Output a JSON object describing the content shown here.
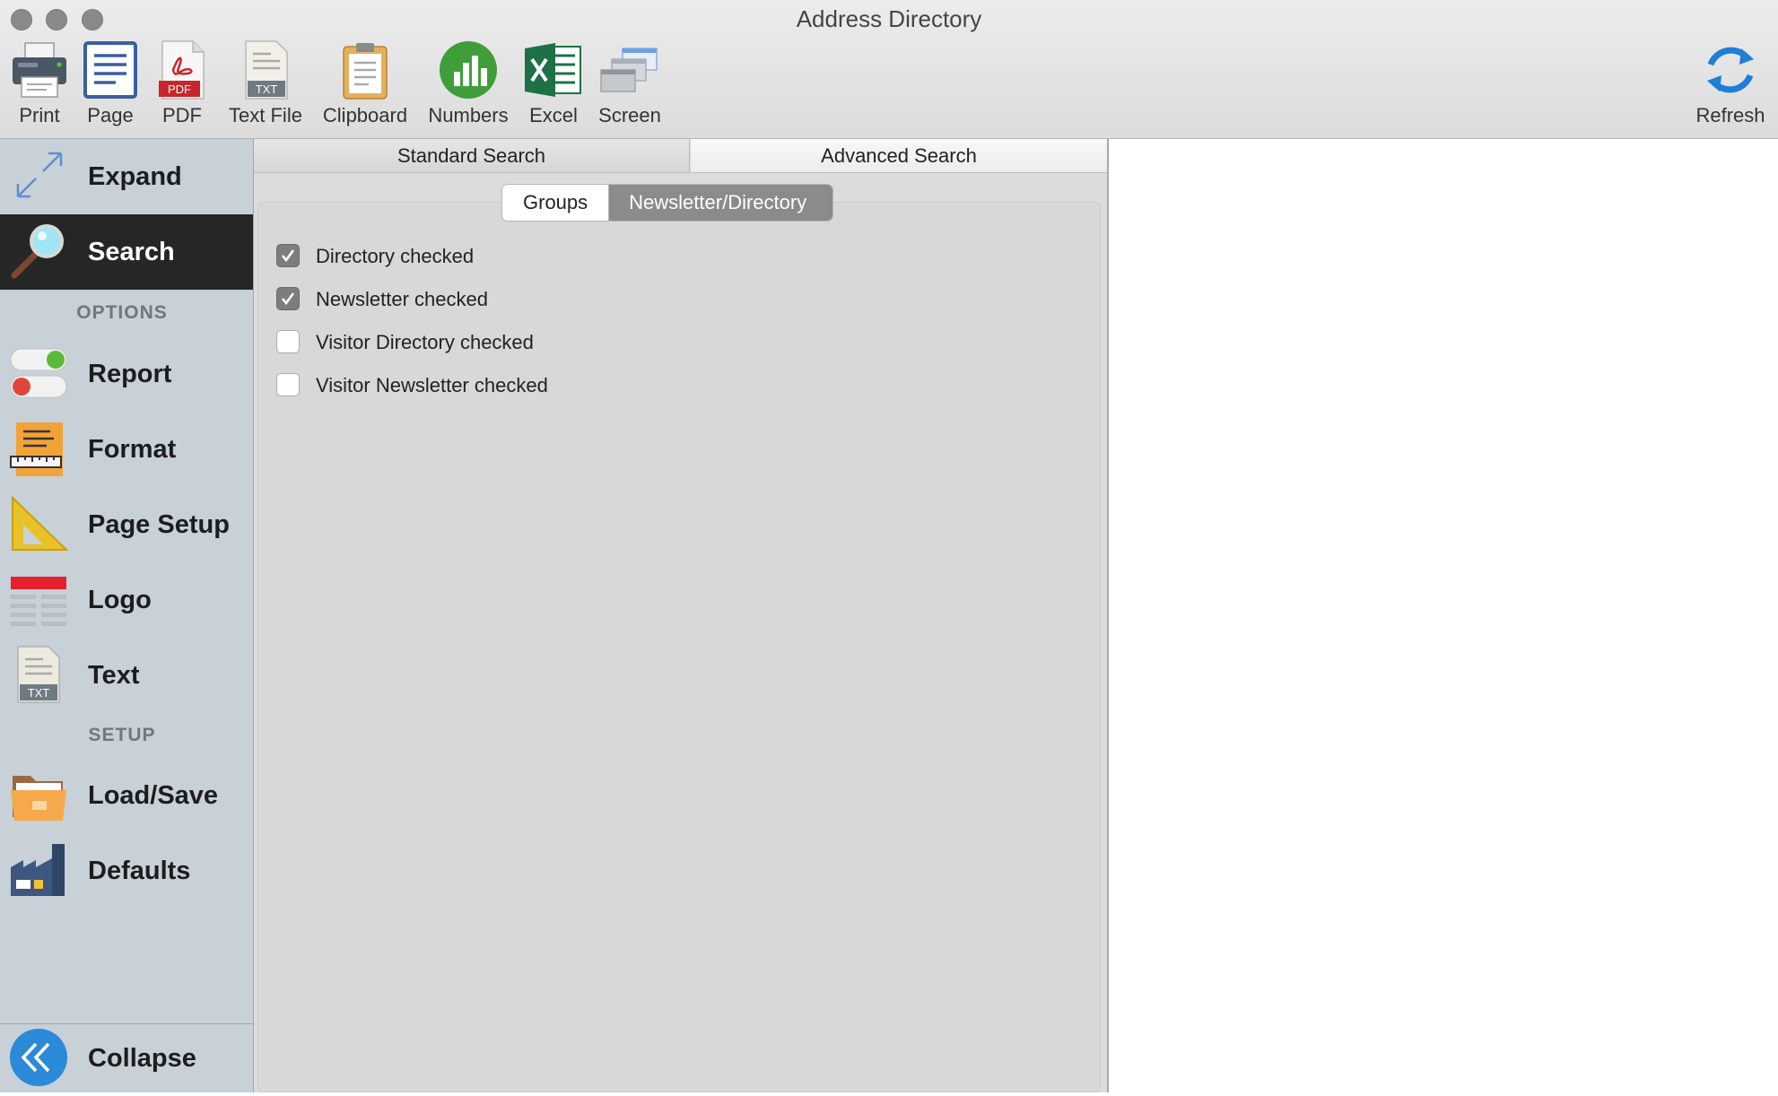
{
  "window": {
    "title": "Address Directory"
  },
  "toolbar": {
    "print": "Print",
    "page": "Page",
    "pdf": "PDF",
    "text_file": "Text File",
    "clipboard": "Clipboard",
    "numbers": "Numbers",
    "excel": "Excel",
    "screen": "Screen",
    "refresh": "Refresh",
    "pdf_badge": "PDF",
    "txt_badge": "TXT"
  },
  "sidebar": {
    "expand": "Expand",
    "search": "Search",
    "options_header": "OPTIONS",
    "report": "Report",
    "format": "Format",
    "page_setup": "Page Setup",
    "logo": "Logo",
    "text": "Text",
    "text_badge": "TXT",
    "setup_header": "SETUP",
    "load_save": "Load/Save",
    "defaults": "Defaults",
    "collapse": "Collapse"
  },
  "tabs": {
    "standard": "Standard Search",
    "advanced": "Advanced Search",
    "selected": "Advanced Search"
  },
  "segments": {
    "groups": "Groups",
    "newsletter": "Newsletter/Directory",
    "selected": "Newsletter/Directory"
  },
  "checkboxes": [
    {
      "label": "Directory checked",
      "checked": true
    },
    {
      "label": "Newsletter checked",
      "checked": true
    },
    {
      "label": "Visitor Directory checked",
      "checked": false
    },
    {
      "label": "Visitor Newsletter checked",
      "checked": false
    }
  ],
  "colors": {
    "accent_blue": "#2b8ad8",
    "sidebar_bg": "#c8d0d8",
    "active_item_bg": "#262626",
    "segment_selected": "#8b8b8b"
  }
}
